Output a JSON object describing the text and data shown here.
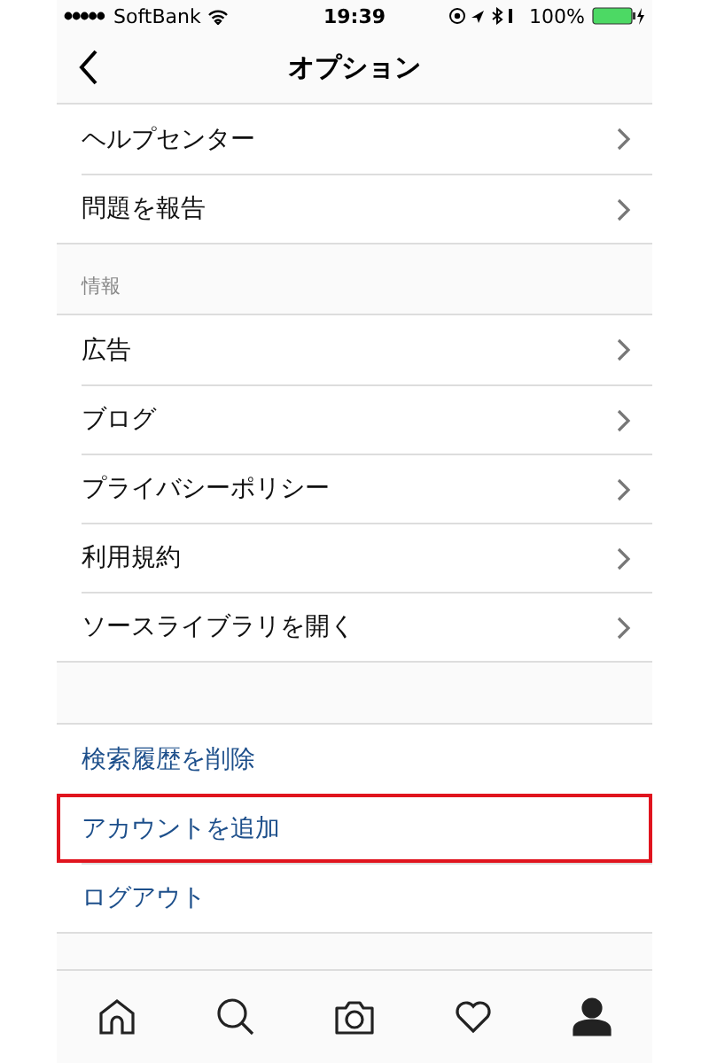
{
  "status_bar": {
    "carrier": "SoftBank",
    "time": "19:39",
    "battery": "100%"
  },
  "nav": {
    "title": "オプション"
  },
  "groups": [
    {
      "items": [
        {
          "label": "ヘルプセンター",
          "kind": "chevron",
          "highlighted": false
        },
        {
          "label": "問題を報告",
          "kind": "chevron",
          "highlighted": false
        }
      ]
    },
    {
      "header": "情報",
      "items": [
        {
          "label": "広告",
          "kind": "chevron",
          "highlighted": false
        },
        {
          "label": "ブログ",
          "kind": "chevron",
          "highlighted": false
        },
        {
          "label": "プライバシーポリシー",
          "kind": "chevron",
          "highlighted": false
        },
        {
          "label": "利用規約",
          "kind": "chevron",
          "highlighted": false
        },
        {
          "label": "ソースライブラリを開く",
          "kind": "chevron",
          "highlighted": false
        }
      ]
    },
    {
      "items": [
        {
          "label": "検索履歴を削除",
          "kind": "action",
          "highlighted": false
        },
        {
          "label": "アカウントを追加",
          "kind": "action",
          "highlighted": true
        },
        {
          "label": "ログアウト",
          "kind": "action",
          "highlighted": false
        }
      ]
    }
  ],
  "tabs": [
    {
      "kind": "home",
      "selected": false
    },
    {
      "kind": "search",
      "selected": false
    },
    {
      "kind": "camera",
      "selected": false
    },
    {
      "kind": "heart",
      "selected": false
    },
    {
      "kind": "profile",
      "selected": true
    }
  ]
}
